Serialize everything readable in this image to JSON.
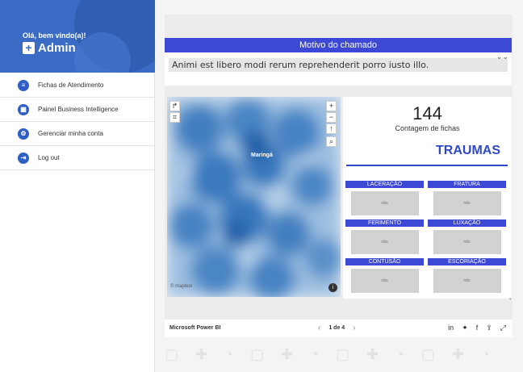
{
  "sidebar": {
    "welcome": "Olá, bem vindo(a)!",
    "user": "Admin",
    "items": [
      {
        "label": "Fichas de Atendimento",
        "icon": "list-icon"
      },
      {
        "label": "Painel Business Intelligence",
        "icon": "dashboard-icon"
      },
      {
        "label": "Gerenciar minha conta",
        "icon": "gear-icon"
      },
      {
        "label": "Log out",
        "icon": "logout-icon"
      }
    ]
  },
  "report": {
    "title": "Motivo do chamado",
    "dropdown_value": "Animi est libero modi rerum reprehenderit porro iusto illo.",
    "map": {
      "city": "Maringá",
      "attribution": "© mapbox",
      "zoom_in": "+",
      "zoom_out": "−"
    },
    "kpi_value": "144",
    "kpi_label": "Contagem de fichas",
    "section_title": "TRAUMAS",
    "tiles": [
      {
        "label": "LACERAÇÃO",
        "value": "não"
      },
      {
        "label": "FRATURA",
        "value": "não"
      },
      {
        "label": "FERIMENTO",
        "value": "não"
      },
      {
        "label": "LUXAÇÃO",
        "value": "não"
      },
      {
        "label": "CONTUSÃO",
        "value": "não"
      },
      {
        "label": "ESCORIAÇÃO",
        "value": "não"
      }
    ]
  },
  "footer": {
    "brand": "Microsoft Power BI",
    "page": "1 de 4",
    "prev": "‹",
    "next": "›"
  },
  "colors": {
    "sidebar_header": "#3a6cc6",
    "accent": "#3c49d4",
    "heatmap": "#2a6fb8"
  }
}
